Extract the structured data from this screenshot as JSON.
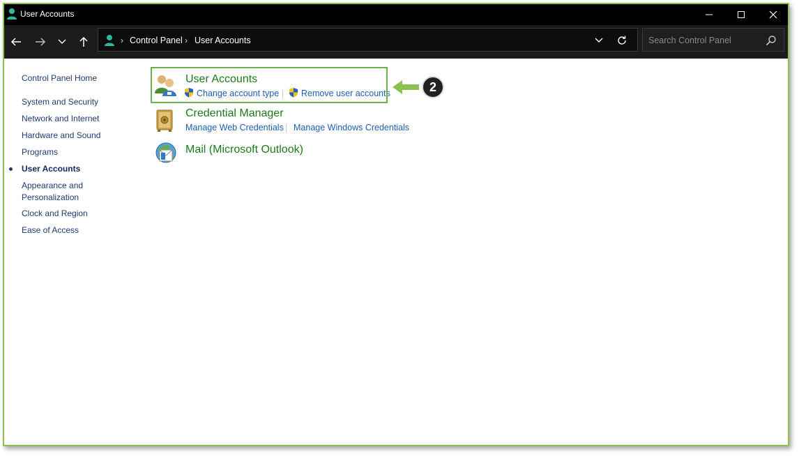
{
  "window": {
    "title": "User Accounts"
  },
  "address": {
    "crumbs": [
      "Control Panel",
      "User Accounts"
    ]
  },
  "search": {
    "placeholder": "Search Control Panel"
  },
  "sidebar": {
    "items": [
      {
        "label": "Control Panel Home",
        "active": false
      },
      {
        "label": "System and Security",
        "active": false
      },
      {
        "label": "Network and Internet",
        "active": false
      },
      {
        "label": "Hardware and Sound",
        "active": false
      },
      {
        "label": "Programs",
        "active": false
      },
      {
        "label": "User Accounts",
        "active": true
      },
      {
        "label": "Appearance and Personalization",
        "active": false
      },
      {
        "label": "Clock and Region",
        "active": false
      },
      {
        "label": "Ease of Access",
        "active": false
      }
    ]
  },
  "categories": [
    {
      "title": "User Accounts",
      "icon": "users-icon",
      "links": [
        "Change account type",
        "Remove user accounts"
      ]
    },
    {
      "title": "Credential Manager",
      "icon": "vault-icon",
      "links": [
        "Manage Web Credentials",
        "Manage Windows Credentials"
      ]
    },
    {
      "title": "Mail (Microsoft Outlook)",
      "icon": "mail-icon",
      "links": []
    }
  ],
  "annotation": {
    "step": "2",
    "highlight_color": "#6ab04c"
  }
}
